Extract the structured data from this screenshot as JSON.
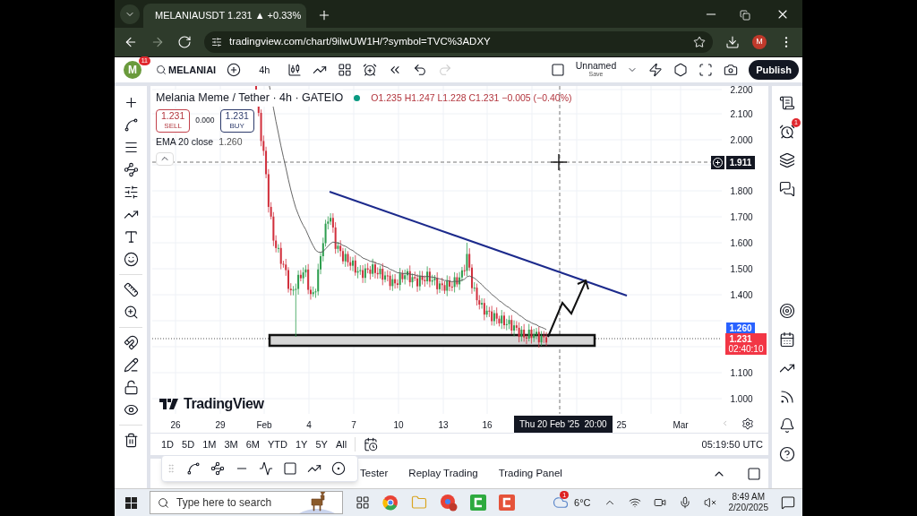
{
  "browser": {
    "tab_title": "MELANIAUSDT 1.231 ▲ +0.33%",
    "url": "tradingview.com/chart/9ilwUW1H/?symbol=TVC%3ADXY",
    "profile": "M"
  },
  "toolbar": {
    "avatar": "M",
    "avatar_badge": "11",
    "symbol": "MELANIAI",
    "interval": "4h",
    "layout_name": "Unnamed",
    "layout_status": "Save",
    "publish": "Publish"
  },
  "legend": {
    "title": "Melania Meme / Tether · 4h · GATEIO",
    "ohlc": "O1.235 H1.247 L1.228 C1.231 −0.005 (−0.40%)",
    "sell_price": "1.231",
    "sell_label": "SELL",
    "spread": "0.000",
    "buy_price": "1.231",
    "buy_label": "BUY",
    "indicator": "EMA 20 close",
    "indicator_value": "1.260"
  },
  "price_axis": {
    "labels": [
      "2.200",
      "2.100",
      "2.000",
      "1.800",
      "1.700",
      "1.600",
      "1.500",
      "1.400",
      "1.100",
      "1.000"
    ],
    "crosshair_price": "1.911",
    "ema_price": "1.260",
    "last_price": "1.231",
    "countdown": "02:40:10"
  },
  "time_axis": {
    "labels": [
      "26",
      "29",
      "Feb",
      "4",
      "7",
      "10",
      "13",
      "16",
      "25",
      "Mar"
    ],
    "crosshair_time": "Thu 20 Feb '25  20:00"
  },
  "logo_text": "TradingView",
  "ranges": [
    "1D",
    "5D",
    "1M",
    "3M",
    "6M",
    "YTD",
    "1Y",
    "5Y",
    "All"
  ],
  "clock": "05:19:50 UTC",
  "bottom_tabs": [
    "Tester",
    "Replay Trading",
    "Trading Panel"
  ],
  "alerts_badge": "1",
  "taskbar": {
    "search_placeholder": "Type here to search",
    "weather_badge": "1",
    "temperature": "6°C",
    "time": "8:49 AM",
    "date": "2/20/2025"
  }
}
